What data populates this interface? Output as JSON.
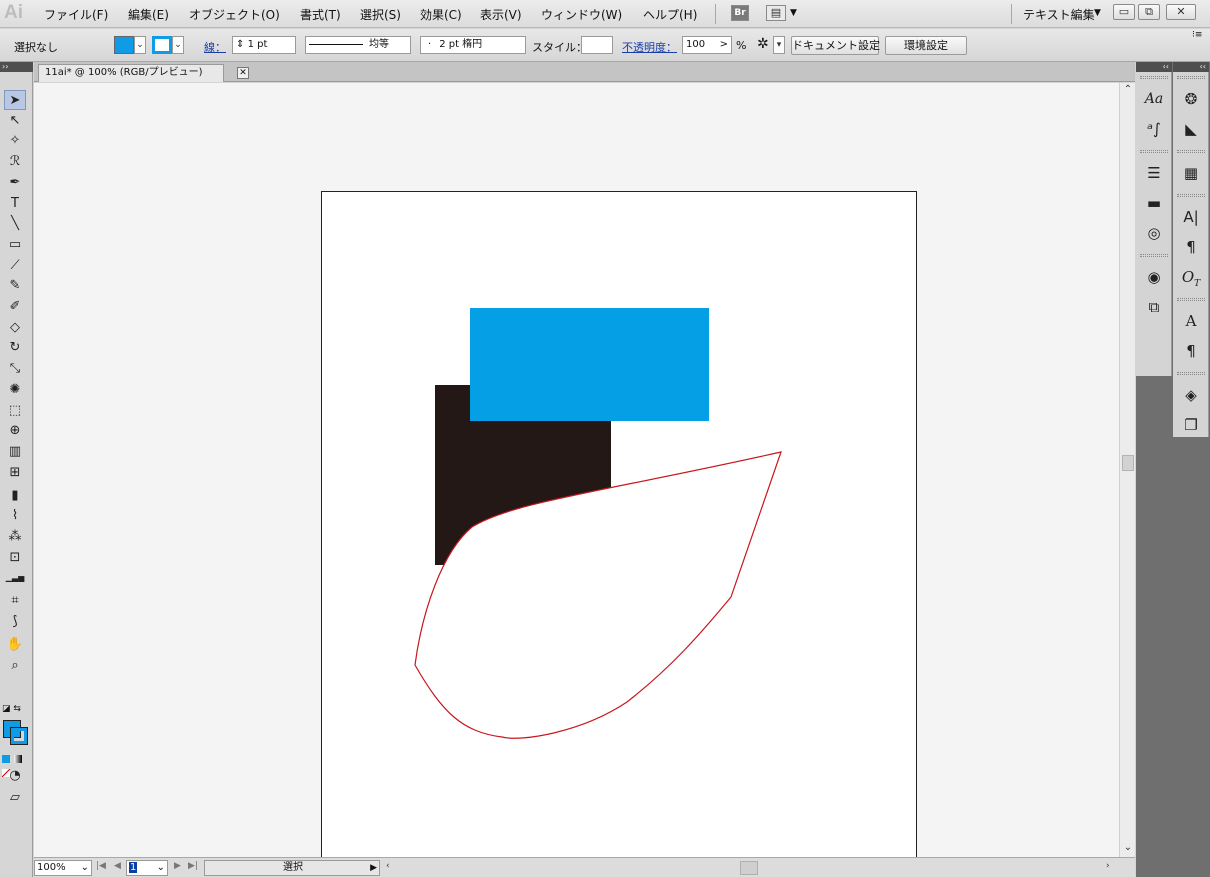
{
  "app": {
    "logo": "Ai",
    "workspace_label": "テキスト編集"
  },
  "menu": {
    "items": [
      "ファイル(F)",
      "編集(E)",
      "オブジェクト(O)",
      "書式(T)",
      "選択(S)",
      "効果(C)",
      "表示(V)",
      "ウィンドウ(W)",
      "ヘルプ(H)"
    ],
    "bridge_label": "Br"
  },
  "window_controls": {
    "minimize": "▭",
    "restore": "⧉",
    "close": "✕"
  },
  "control_bar": {
    "selection_label": "選択なし",
    "fill_color": "#0f9be6",
    "stroke_color": "#0f9be6",
    "stroke_label": "線：",
    "stroke_weight": "1 pt",
    "stroke_profile": "均等",
    "brush_label": "2 pt 楕円",
    "style_label": "スタイル：",
    "opacity_label": "不透明度：",
    "opacity_value": "100",
    "opacity_unit": "%",
    "document_setup_button": "ドキュメント設定",
    "preferences_button": "環境設定"
  },
  "document": {
    "tab_title": "11ai* @ 100% (RGB/プレビュー)",
    "tab_close": "✕"
  },
  "artwork": {
    "blue_rect_color": "#059fe5",
    "dark_rect_color": "#231816",
    "path_stroke_color": "#c8171e"
  },
  "status_bar": {
    "zoom": "100%",
    "artboard_number": "1",
    "status_text": "選択"
  },
  "tools": [
    "selection-tool",
    "direct-selection-tool",
    "magic-wand-tool",
    "lasso-tool",
    "pen-tool",
    "type-tool",
    "line-segment-tool",
    "rectangle-tool",
    "paintbrush-tool",
    "pencil-tool",
    "blob-brush-tool",
    "eraser-tool",
    "rotate-tool",
    "scale-tool",
    "warp-tool",
    "free-transform-tool",
    "shape-builder-tool",
    "perspective-grid-tool",
    "mesh-tool",
    "gradient-tool",
    "eyedropper-tool",
    "blend-tool",
    "symbol-sprayer-tool",
    "column-graph-tool",
    "artboard-tool",
    "slice-tool",
    "hand-tool",
    "zoom-tool"
  ]
}
